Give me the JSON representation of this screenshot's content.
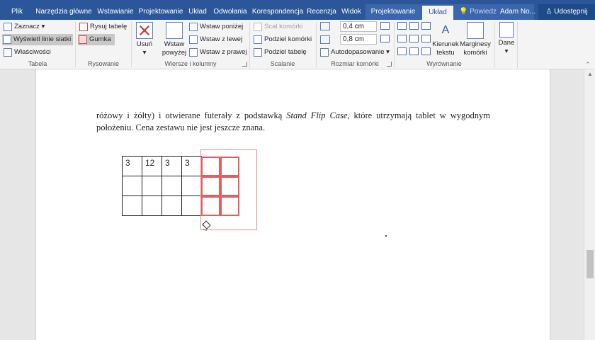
{
  "tabs": {
    "file": "Plik",
    "home": "Narzędzia główne",
    "insert": "Wstawianie",
    "design": "Projektowanie",
    "layout": "Układ",
    "references": "Odwołania",
    "mailings": "Korespondencja",
    "review": "Recenzja",
    "view": "Widok",
    "table_design": "Projektowanie",
    "table_layout": "Układ",
    "tell_me": "Powiedz",
    "user": "Adam No...",
    "share": "Udostępnij"
  },
  "ribbon": {
    "table": {
      "select": "Zaznacz",
      "gridlines": "Wyświetl linie siatki",
      "properties": "Właściwości",
      "label": "Tabela"
    },
    "draw": {
      "draw_table": "Rysuj tabelę",
      "eraser": "Gumka",
      "label": "Rysowanie"
    },
    "rows_cols": {
      "delete": "Usuń",
      "insert_above": "Wstaw powyżej",
      "insert_below": "Wstaw poniżej",
      "insert_left": "Wstaw z lewej",
      "insert_right": "Wstaw z prawej",
      "label": "Wiersze i kolumny"
    },
    "merge": {
      "merge_cells": "Scal komórki",
      "split_cells": "Podziel komórki",
      "split_table": "Podziel tabelę",
      "label": "Scalanie"
    },
    "cell_size": {
      "height": "0,4 cm",
      "width": "0,8 cm",
      "autofit": "Autodopasowanie",
      "label": "Rozmiar komórki"
    },
    "alignment": {
      "direction": "Kierunek tekstu",
      "margins": "Marginesy komórki",
      "label": "Wyrównanie"
    },
    "data": {
      "label": "Dane"
    }
  },
  "document": {
    "paragraph_before": "różowy i żółty) i otwierane futerały z podstawką ",
    "paragraph_italic": "Stand Flip Case",
    "paragraph_after": ", które utrzymają tablet w wygodnym położeniu. Cena zestawu nie jest jeszcze znana.",
    "table_rows": [
      [
        "3",
        "12",
        "3",
        "3"
      ],
      [
        "",
        "",
        "",
        ""
      ],
      [
        "",
        "",
        "",
        ""
      ]
    ]
  },
  "colors": {
    "brand": "#2b579a",
    "drawn_border": "#e06060"
  },
  "icons": [
    "eraser-icon",
    "lightbulb-icon",
    "person-icon"
  ]
}
